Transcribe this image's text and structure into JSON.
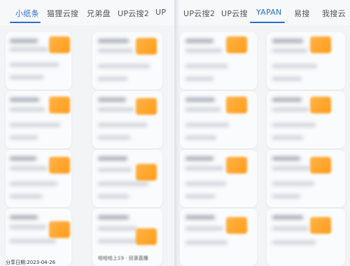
{
  "left_panel": {
    "tabs": [
      {
        "label": "小纸条"
      },
      {
        "label": "猫狸云搜"
      },
      {
        "label": "兄弟盘"
      },
      {
        "label": "UP云搜2"
      },
      {
        "label": "UP"
      }
    ],
    "active_tab": "小纸条",
    "footer_date": "分享日期:2023-04-26",
    "footer_right": "哈哈哈上19 · 目录直播"
  },
  "right_panel": {
    "tabs": [
      {
        "label": "UP云搜2"
      },
      {
        "label": "UP云搜"
      },
      {
        "label": "YAPAN"
      },
      {
        "label": "易搜"
      },
      {
        "label": "我搜云"
      }
    ],
    "active_tab": "YAPAN"
  },
  "colors": {
    "accent": "#2a6fc9",
    "thumbnail": "#ff9c1a"
  }
}
